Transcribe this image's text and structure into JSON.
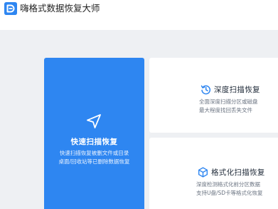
{
  "app": {
    "title": "嗨格式数据恢复大师",
    "logo_icon": "d-logo-icon",
    "brand_color": "#2e86f1"
  },
  "modes": {
    "quick": {
      "title": "快速扫描恢复",
      "desc_line1": "快速扫描恢复被删文件或目录",
      "desc_line2": "桌面/回收站等已删除数据恢复",
      "icon": "navigation-arrow-icon"
    },
    "deep": {
      "title": "深度扫描恢复",
      "desc_line1": "全面深度扫描分区或磁盘",
      "desc_line2": "最大程度找回丢失文件",
      "icon": "history-clock-icon"
    },
    "format": {
      "title": "格式化扫描恢复",
      "desc_line1": "深度检测格式化前分区数据",
      "desc_line2": "支持U盘/SD卡等格式化恢复",
      "icon": "cube-icon"
    }
  }
}
